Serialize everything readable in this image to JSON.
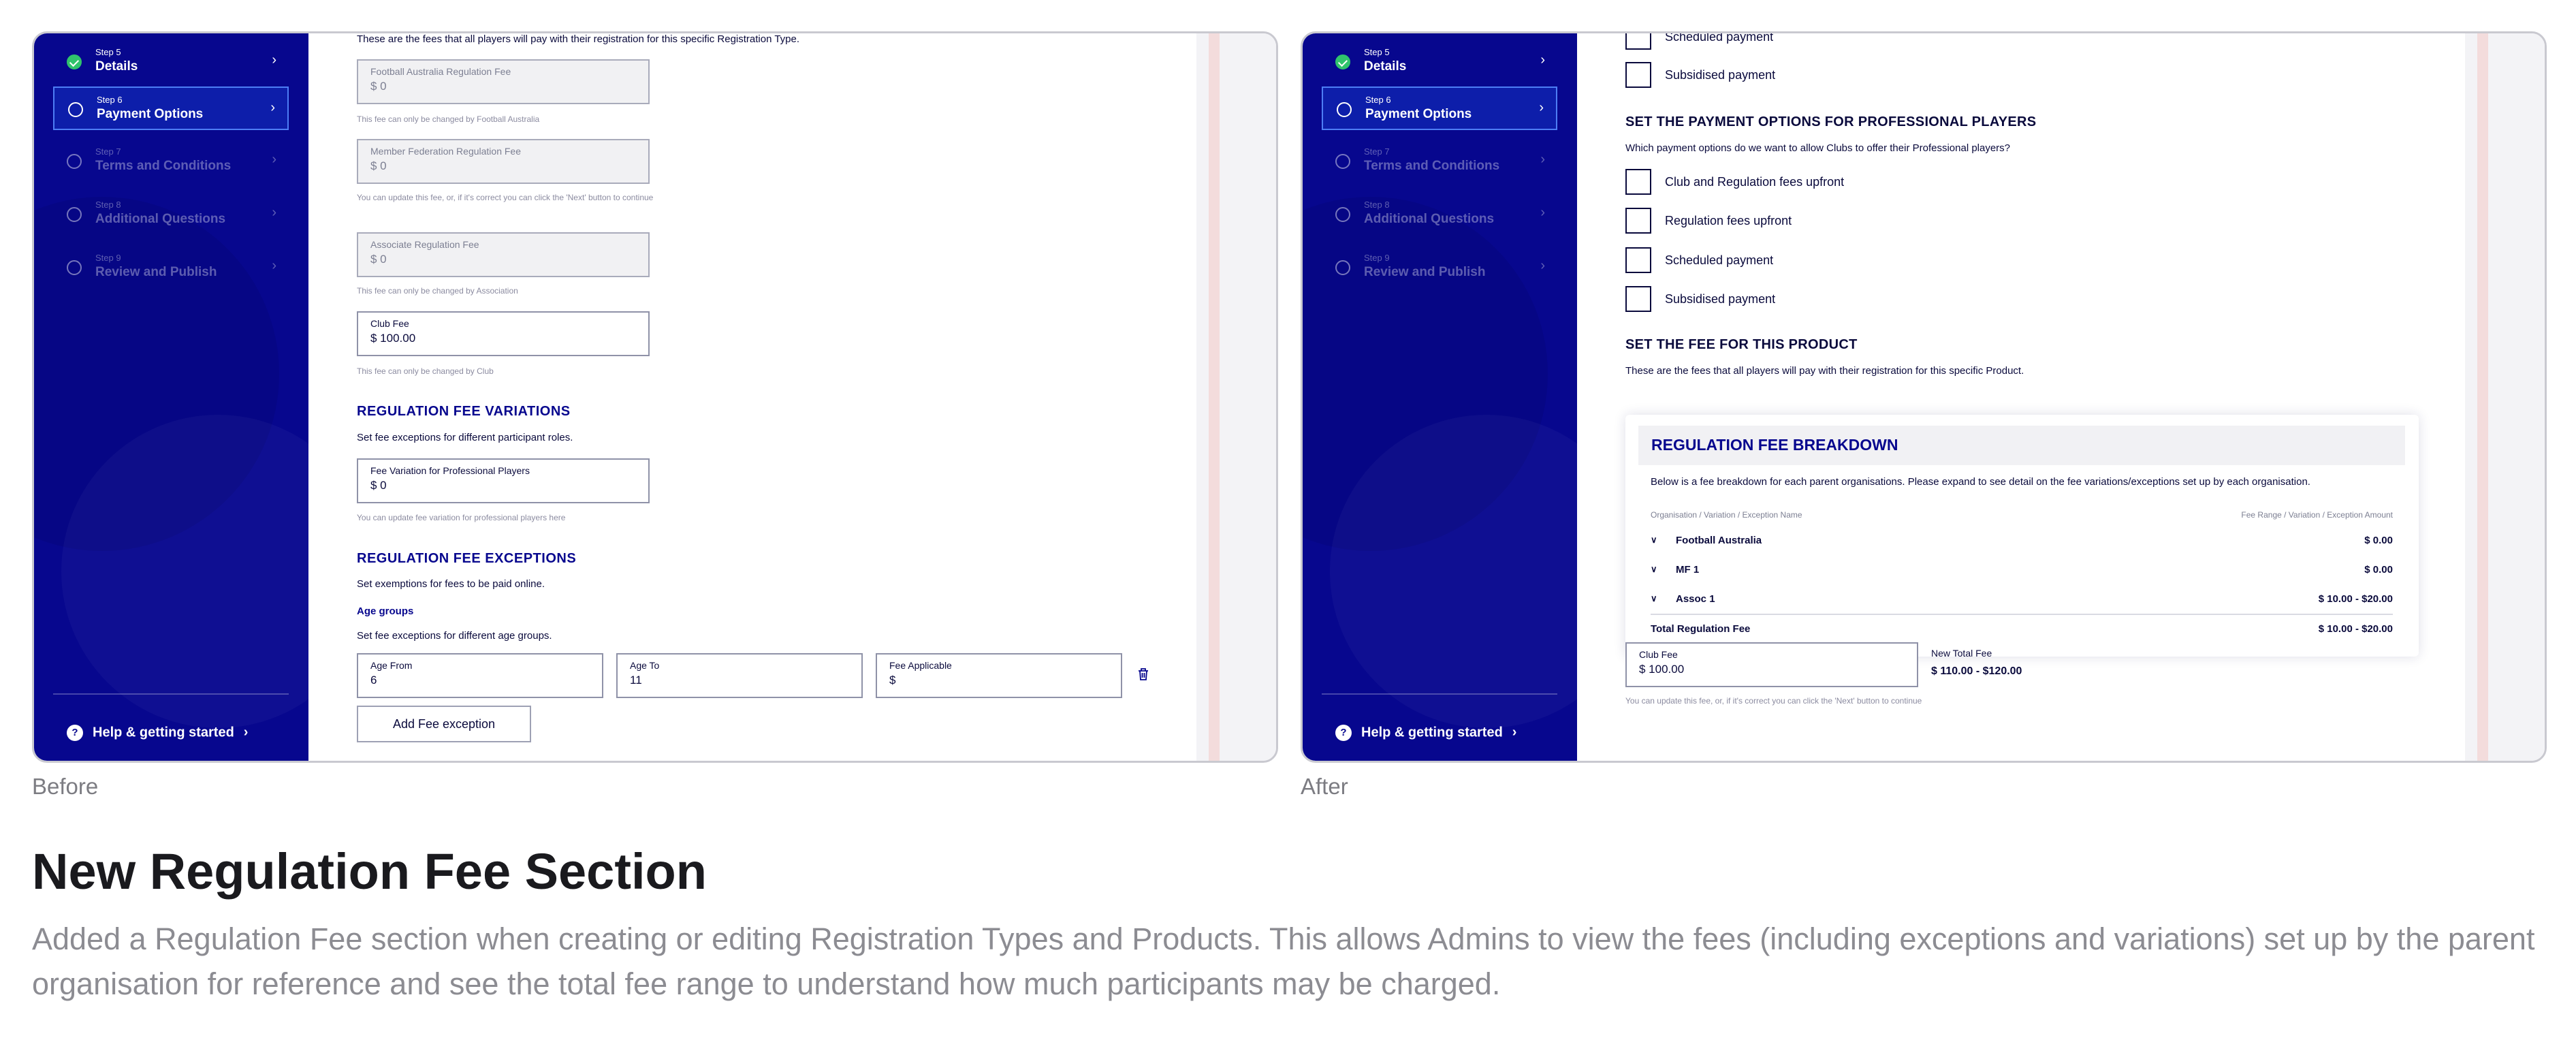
{
  "before": {
    "caption": "Before",
    "sidebar": {
      "steps": [
        {
          "num": "Step 5",
          "label": "Details",
          "state": "done"
        },
        {
          "num": "Step 6",
          "label": "Payment Options",
          "state": "active"
        },
        {
          "num": "Step 7",
          "label": "Terms and Conditions",
          "state": "dim"
        },
        {
          "num": "Step 8",
          "label": "Additional Questions",
          "state": "dim"
        },
        {
          "num": "Step 9",
          "label": "Review and Publish",
          "state": "dim"
        }
      ],
      "help": "Help & getting started"
    },
    "main": {
      "intro": "These are the fees that all players will pay with their registration for this specific Registration Type.",
      "fees": [
        {
          "label": "Football Australia Regulation Fee",
          "value": "$ 0",
          "hint": "This fee can only be changed by Football Australia",
          "disabled": true
        },
        {
          "label": "Member Federation Regulation Fee",
          "value": "$ 0",
          "hint": "You can update this fee, or, if it's correct you can click the 'Next' button to continue",
          "disabled": true
        },
        {
          "label": "Associate Regulation Fee",
          "value": "$ 0",
          "hint": "This fee can only be changed by Association",
          "disabled": true
        },
        {
          "label": "Club Fee",
          "value": "$ 100.00",
          "hint": "This fee can only be changed by Club",
          "disabled": false
        }
      ],
      "variations": {
        "title": "REGULATION FEE VARIATIONS",
        "desc": "Set fee exceptions for different participant roles.",
        "field_label": "Fee Variation for Professional Players",
        "field_value": "$ 0",
        "hint": "You can update fee variation for professional players here"
      },
      "exceptions": {
        "title": "REGULATION FEE EXCEPTIONS",
        "desc": "Set exemptions for fees to be paid online.",
        "age_title": "Age groups",
        "age_desc": "Set fee exceptions for different age groups.",
        "age_from_label": "Age From",
        "age_from_value": "6",
        "age_to_label": "Age To",
        "age_to_value": "11",
        "fee_label": "Fee Applicable",
        "fee_value": "$",
        "add_button": "Add Fee exception"
      },
      "progress": 0.23
    }
  },
  "after": {
    "caption": "After",
    "sidebar": {
      "steps": [
        {
          "num": "Step 5",
          "label": "Details",
          "state": "done"
        },
        {
          "num": "Step 6",
          "label": "Payment Options",
          "state": "active"
        },
        {
          "num": "Step 7",
          "label": "Terms and Conditions",
          "state": "dim"
        },
        {
          "num": "Step 8",
          "label": "Additional Questions",
          "state": "dim"
        },
        {
          "num": "Step 9",
          "label": "Review and Publish",
          "state": "dim"
        }
      ],
      "help": "Help & getting started"
    },
    "main": {
      "top_options": [
        "Scheduled payment",
        "Subsidised payment"
      ],
      "pro_title": "SET THE PAYMENT OPTIONS FOR PROFESSIONAL PLAYERS",
      "pro_desc": "Which payment options do we want to allow Clubs to offer their Professional players?",
      "pro_options": [
        "Club and Regulation fees upfront",
        "Regulation fees upfront",
        "Scheduled payment",
        "Subsidised payment"
      ],
      "fee_title": "SET THE FEE FOR THIS PRODUCT",
      "fee_desc": "These are the fees that all players will pay with their registration for this specific Product.",
      "breakdown": {
        "title": "REGULATION FEE BREAKDOWN",
        "desc": "Below is a fee breakdown for each parent organisations. Please expand to see detail on the fee variations/exceptions set up by each organisation.",
        "col_left": "Organisation / Variation / Exception Name",
        "col_right": "Fee Range / Variation / Exception Amount",
        "rows": [
          {
            "name": "Football Australia",
            "value": "$ 0.00"
          },
          {
            "name": "MF 1",
            "value": "$ 0.00"
          },
          {
            "name": "Assoc 1",
            "value": "$ 10.00 - $20.00"
          }
        ],
        "total_label": "Total Regulation Fee",
        "total_value": "$ 10.00 - $20.00"
      },
      "club_fee_label": "Club Fee",
      "club_fee_value": "$ 100.00",
      "new_total_label": "New Total Fee",
      "new_total_value": "$ 110.00 - $120.00",
      "club_hint": "You can update this fee, or, if it's correct you can click the 'Next' button to continue",
      "progress": 0.23
    }
  },
  "heading": "New Regulation Fee Section",
  "description": "Added a Regulation Fee section when creating or editing Registration Types and Products. This allows Admins to view the fees (including exceptions and variations) set up by the parent organisation for reference and see the total fee range to understand how much participants may be charged."
}
